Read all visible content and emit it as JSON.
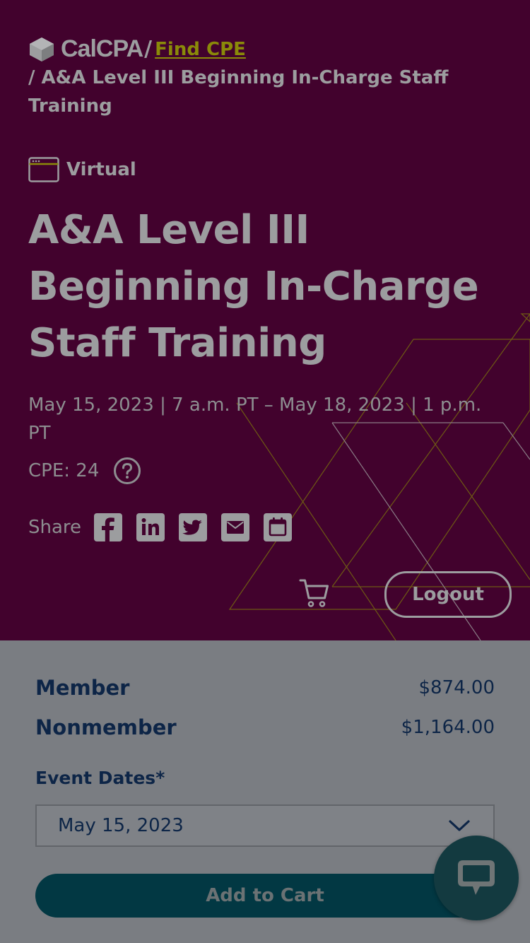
{
  "breadcrumb": {
    "logo_text": "CalCPA",
    "separator": "/",
    "link_label": "Find CPE",
    "current": "/ A&A Level III Beginning In-Charge Staff Training"
  },
  "event": {
    "format": "Virtual",
    "title": "A&A Level III Beginning In-Charge Staff Training",
    "dates": "May 15, 2023 | 7 a.m. PT – May 18, 2023 | 1 p.m. PT",
    "cpe": "CPE: 24"
  },
  "share": {
    "label": "Share",
    "icons": [
      "facebook-icon",
      "linkedin-icon",
      "twitter-icon",
      "email-icon",
      "calendar-icon"
    ]
  },
  "header_actions": {
    "logout_label": "Logout"
  },
  "pricing": {
    "member_label": "Member",
    "member_price": "$874.00",
    "nonmember_label": "Nonmember",
    "nonmember_price": "$1,164.00"
  },
  "registration": {
    "event_dates_label": "Event Dates*",
    "selected_date": "May 15, 2023",
    "add_to_cart_label": "Add to Cart"
  },
  "colors": {
    "hero_bg": "#42022d",
    "link": "#8a8a09",
    "navy": "#0d2547",
    "teal": "#023843"
  }
}
